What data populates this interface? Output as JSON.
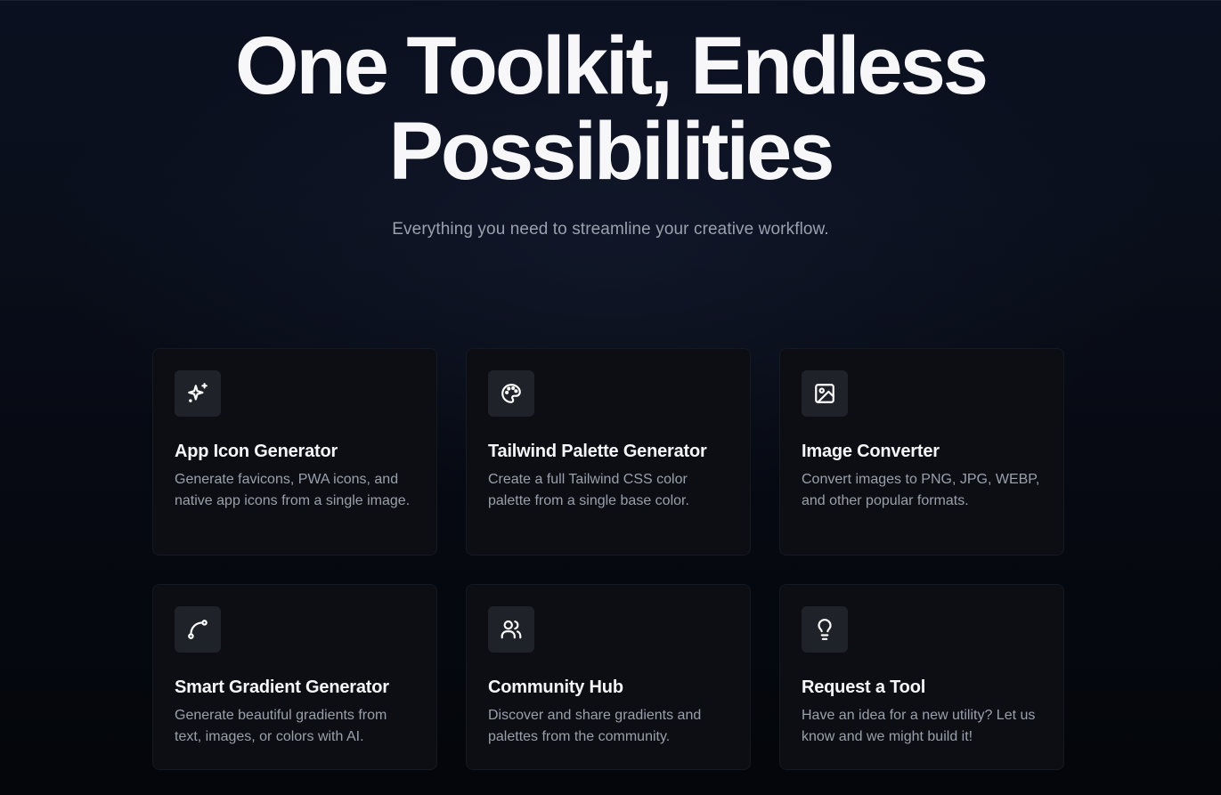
{
  "hero": {
    "title_line1": "One Toolkit, Endless",
    "title_line2": "Possibilities",
    "subtitle": "Everything you need to streamline your creative workflow."
  },
  "tools": [
    {
      "icon": "sparkles-icon",
      "title": "App Icon Generator",
      "description": "Generate favicons, PWA icons, and native app icons from a single image."
    },
    {
      "icon": "palette-icon",
      "title": "Tailwind Palette Generator",
      "description": "Create a full Tailwind CSS color palette from a single base color."
    },
    {
      "icon": "image-icon",
      "title": "Image Converter",
      "description": "Convert images to PNG, JPG, WEBP, and other popular formats."
    },
    {
      "icon": "spline-icon",
      "title": "Smart Gradient Generator",
      "description": "Generate beautiful gradients from text, images, or colors with AI."
    },
    {
      "icon": "users-icon",
      "title": "Community Hub",
      "description": "Discover and share gradients and palettes from the community."
    },
    {
      "icon": "lightbulb-icon",
      "title": "Request a Tool",
      "description": "Have an idea for a new utility? Let us know and we might build it!"
    }
  ],
  "colors": {
    "background": "#05070d",
    "card_background": "#0c0e14",
    "card_border": "#151922",
    "icon_background": "#1f2229",
    "title_text": "#f7f7f9",
    "muted_text": "#9ba0ad"
  }
}
